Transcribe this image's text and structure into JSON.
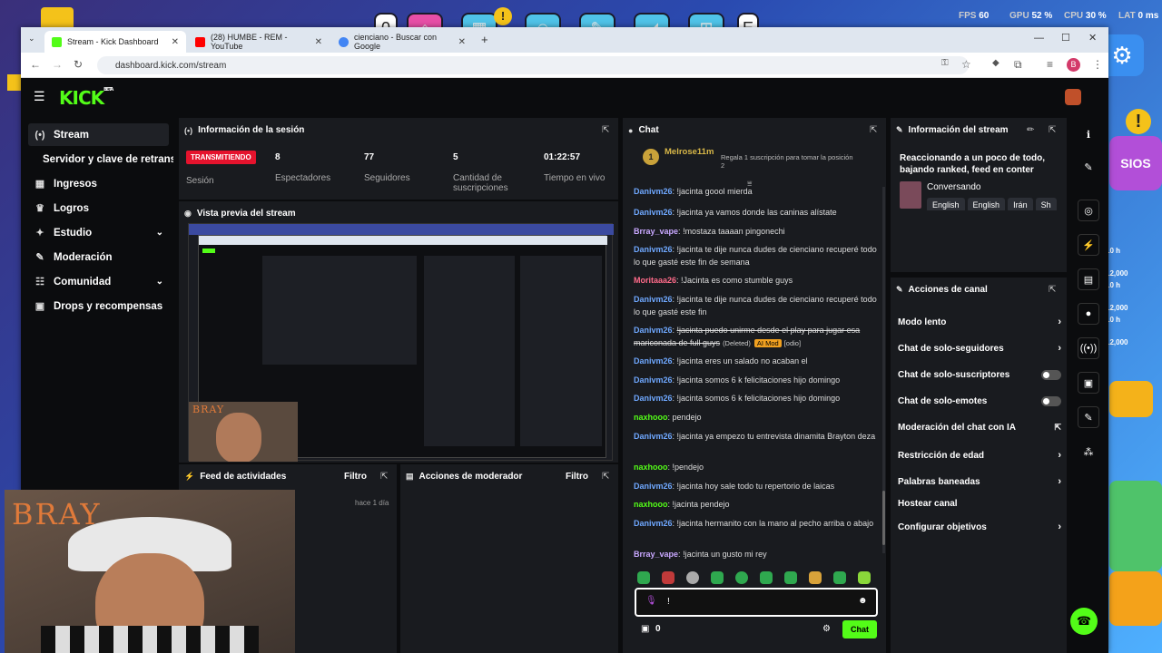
{
  "game": {
    "fps_label": "FPS",
    "fps": "60",
    "gpu_label": "GPU",
    "gpu": "52 %",
    "cpu_label": "CPU",
    "cpu": "30 %",
    "lat_label": "LAT",
    "lat": "0 ms",
    "side_timers": [
      "10 h",
      "10 h",
      "10 h"
    ],
    "side_prices": [
      "12,000",
      "12,000",
      "12,000"
    ],
    "side_word": "SIOS"
  },
  "browser": {
    "tabs": [
      {
        "label": "Stream - Kick Dashboard",
        "color": "#53fc18"
      },
      {
        "label": "(28) HUMBE - REM - YouTube",
        "color": "#ff0000"
      },
      {
        "label": "cienciano - Buscar con Google",
        "color": "#4285f4"
      }
    ],
    "url": "dashboard.kick.com/stream",
    "profile_initial": "B",
    "new_tab": "+"
  },
  "kick": {
    "logo": "KICK",
    "logo_badge": "BETA",
    "sidebar": [
      {
        "label": "Stream",
        "icon": "broadcast-icon"
      },
      {
        "label": "Servidor y clave de retransmisión",
        "icon": ""
      },
      {
        "label": "Ingresos",
        "icon": "money-icon"
      },
      {
        "label": "Logros",
        "icon": "trophy-icon"
      },
      {
        "label": "Estudio",
        "icon": "palette-icon"
      },
      {
        "label": "Moderación",
        "icon": "wrench-icon"
      },
      {
        "label": "Comunidad",
        "icon": "people-icon"
      },
      {
        "label": "Drops y recompensas",
        "icon": "gift-icon"
      }
    ],
    "session": {
      "title": "Información de la sesión",
      "status": "TRANSMITIENDO",
      "status_label": "Sesión",
      "stats": [
        {
          "value": "8",
          "label": "Espectadores"
        },
        {
          "value": "77",
          "label": "Seguidores"
        },
        {
          "value": "5",
          "label": "Cantidad de suscripciones"
        },
        {
          "value": "01:22:57",
          "label": "Tiempo en vivo"
        }
      ]
    },
    "preview": {
      "title": "Vista previa del stream",
      "webcam_text": "BRAY"
    },
    "activity": {
      "title": "Feed de actividades",
      "filter": "Filtro",
      "item_time": "hace 1 día"
    },
    "mod_actions": {
      "title": "Acciones de moderador",
      "filter": "Filtro"
    },
    "chat": {
      "title": "Chat",
      "pinned_user": "Melrose11m",
      "pinned_count": "1",
      "gift_text": "Regala 1 suscripción para tomar la posición 2",
      "messages": [
        {
          "user": "Danivm26",
          "text": "!jacinta goool mierda"
        },
        {
          "user": "Danivm26",
          "text": "!jacinta ya vamos donde las caninas alístate"
        },
        {
          "user": "Brray_vape",
          "text": "!mostaza taaaan pingonechi"
        },
        {
          "user": "Danivm26",
          "text": "!jacinta te dije nunca dudes de cienciano recuperé todo lo que gasté este fin de semana"
        },
        {
          "user": "Moritaaa26",
          "text": "!Jacinta es como stumble guys"
        },
        {
          "user": "Danivm26",
          "text": "!jacinta te dije nunca dudes de cienciano recuperé todo lo que gasté este fin"
        },
        {
          "user": "Danivm26",
          "text": "!jacinta puedo unirme desde el play para jugar esa mariconada de full guys",
          "deleted": "(Deleted)",
          "mod_tag": "AI Mod",
          "reason": "[odio]"
        },
        {
          "user": "Danivm26",
          "text": "!jacinta eres un salado no acaban el"
        },
        {
          "user": "Danivm26",
          "text": "!jacinta somos 6 k felicitaciones hijo domingo"
        },
        {
          "user": "Danivm26",
          "text": "!jacinta somos 6 k felicitaciones hijo domingo"
        },
        {
          "user": "naxhooo",
          "text": "pendejo"
        },
        {
          "user": "Danivm26",
          "text": "!jacinta ya empezo tu entrevista dinamita Brayton deza"
        },
        {
          "user": "naxhooo",
          "text": "!pendejo"
        },
        {
          "user": "Danivm26",
          "text": "!jacinta hoy sale todo tu repertorio de laicas"
        },
        {
          "user": "naxhooo",
          "text": "!jacinta pendejo"
        },
        {
          "user": "Danivm26",
          "text": "!jacinta hermanito con la mano al pecho arriba o abajo"
        },
        {
          "user": "Brray_vape",
          "text": "!jacinta un gusto mi rey"
        }
      ],
      "input_value": "!",
      "points": "0",
      "send": "Chat"
    },
    "stream_info": {
      "title": "Información del stream",
      "stream_title": "Reaccionando a un poco de todo, bajando ranked, feed en conter",
      "category": "Conversando",
      "tags": [
        "English",
        "English",
        "Irán",
        "Sh"
      ]
    },
    "channel_actions": {
      "title": "Acciones de canal",
      "rows": [
        {
          "label": "Modo lento",
          "type": "arrow"
        },
        {
          "label": "Chat de solo-seguidores",
          "type": "arrow"
        },
        {
          "label": "Chat de solo-suscriptores",
          "type": "toggle"
        },
        {
          "label": "Chat de solo-emotes",
          "type": "toggle"
        },
        {
          "label": "Moderación del chat con IA",
          "type": "link"
        },
        {
          "label": "Restricción de edad",
          "type": "arrow"
        },
        {
          "label": "Palabras baneadas",
          "type": "arrow"
        },
        {
          "label": "Hostear canal",
          "type": "none"
        },
        {
          "label": "Configurar objetivos",
          "type": "arrow"
        }
      ]
    },
    "webcam_overlay_text": "BRAY"
  }
}
